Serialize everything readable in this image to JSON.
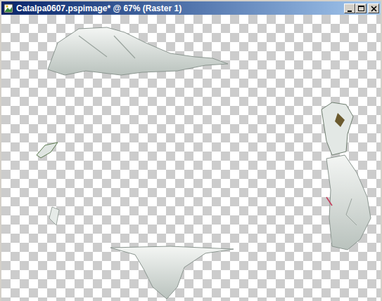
{
  "window": {
    "title": "Catalpa0607.pspimage* @ 67% (Raster 1)"
  }
}
